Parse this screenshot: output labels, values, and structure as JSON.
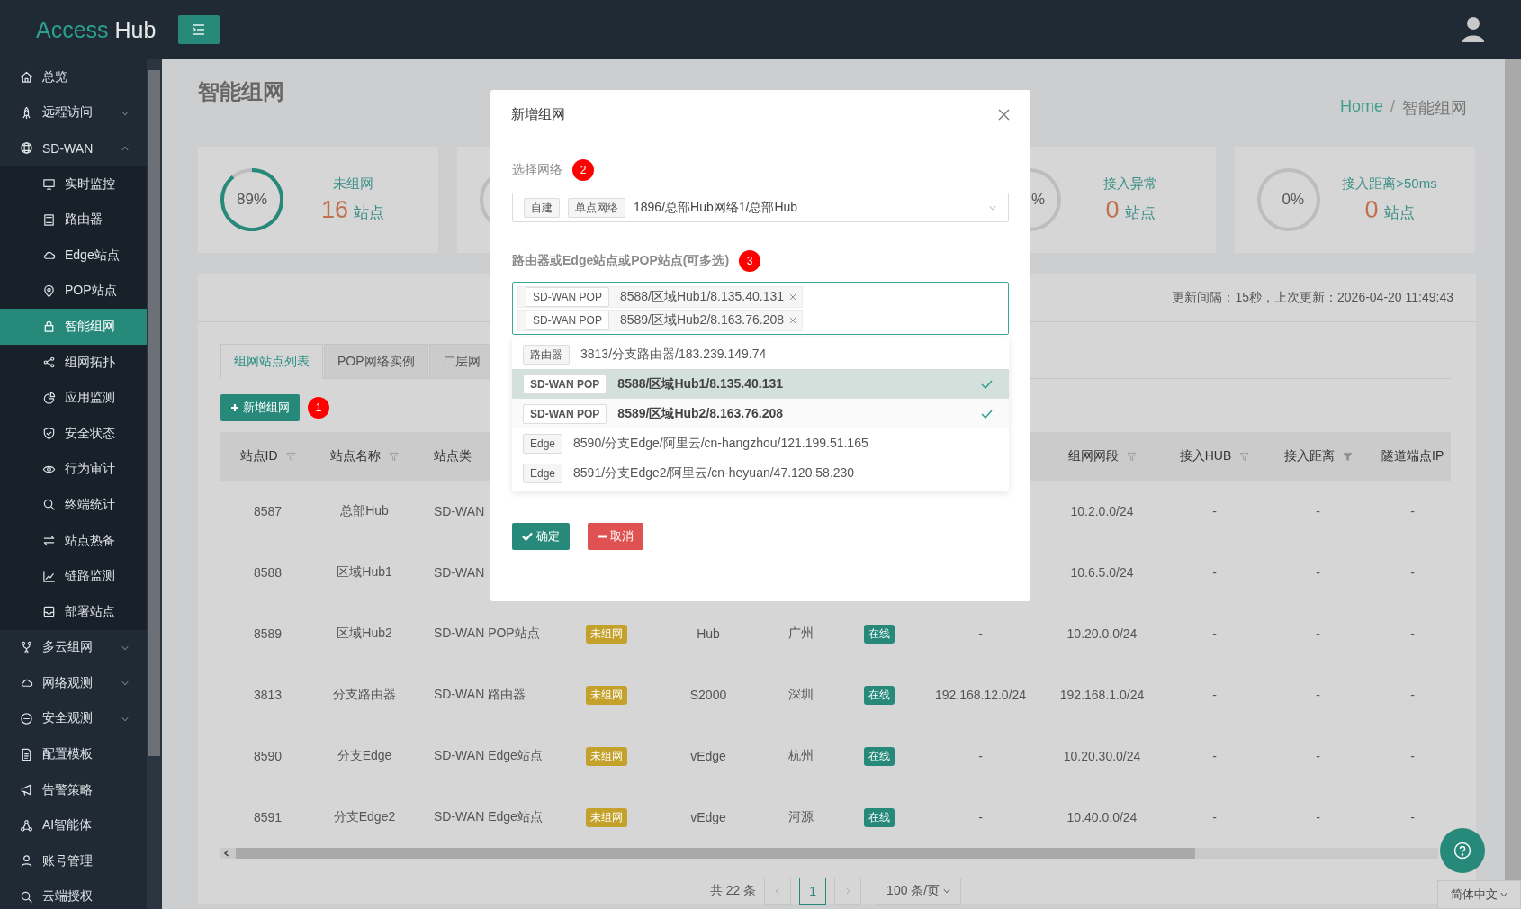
{
  "header": {
    "logo": {
      "first": "Access",
      "second": "Hub"
    }
  },
  "sidebar": {
    "items": [
      {
        "label": "总览",
        "selected": false
      },
      {
        "label": "远程访问",
        "selected": false,
        "expanded": false
      },
      {
        "label": "SD-WAN",
        "selected": false,
        "expanded": true,
        "children": [
          {
            "label": "实时监控",
            "selected": false
          },
          {
            "label": "路由器",
            "selected": false
          },
          {
            "label": "Edge站点",
            "selected": false
          },
          {
            "label": "POP站点",
            "selected": false
          },
          {
            "label": "智能组网",
            "selected": true
          },
          {
            "label": "组网拓扑",
            "selected": false
          },
          {
            "label": "应用监测",
            "selected": false
          },
          {
            "label": "安全状态",
            "selected": false
          },
          {
            "label": "行为审计",
            "selected": false
          },
          {
            "label": "终端统计",
            "selected": false
          },
          {
            "label": "站点热备",
            "selected": false
          },
          {
            "label": "链路监测",
            "selected": false
          },
          {
            "label": "部署站点",
            "selected": false
          }
        ]
      },
      {
        "label": "多云组网",
        "selected": false,
        "expanded": false
      },
      {
        "label": "网络观测",
        "selected": false,
        "expanded": false
      },
      {
        "label": "安全观测",
        "selected": false,
        "expanded": false
      },
      {
        "label": "配置模板",
        "selected": false
      },
      {
        "label": "告警策略",
        "selected": false
      },
      {
        "label": "AI智能体",
        "selected": false
      },
      {
        "label": "账号管理",
        "selected": false
      },
      {
        "label": "云端授权",
        "selected": false
      }
    ]
  },
  "page": {
    "title": "智能组网",
    "breadcrumb": {
      "home": "Home",
      "separator": "/",
      "current": "智能组网"
    }
  },
  "stats": [
    {
      "kind": "stat",
      "ring_label": "89%",
      "title": "未组网",
      "count": "16",
      "unit": "站点"
    },
    {
      "kind": "stat"
    },
    {
      "kind": "stat",
      "ring_label": "%",
      "title": "接入异常",
      "count": "0",
      "unit": "站点"
    },
    {
      "kind": "stat",
      "ring_label": "0%",
      "title": "接入距离>50ms",
      "count": "0",
      "unit": "站点"
    }
  ],
  "update_info": "更新间隔：15秒，上次更新：2026-04-20 11:49:43",
  "tabs": [
    {
      "label": "组网站点列表",
      "selected": true
    },
    {
      "label": "POP网络实例",
      "selected": false
    },
    {
      "label": "二层网",
      "selected": false
    }
  ],
  "add_button": {
    "label": "新增组网",
    "step": "1"
  },
  "table": {
    "columns": [
      {
        "kind": "text",
        "label": "站点ID",
        "filtered": false
      },
      {
        "kind": "text",
        "label": "站点名称",
        "filtered": false
      },
      {
        "kind": "text",
        "label": "站点类"
      },
      {
        "kind": "badge",
        "color": "#c4a12a"
      },
      {
        "kind": "text"
      },
      {
        "kind": "text"
      },
      {
        "kind": "badge",
        "color": "#26897a"
      },
      {
        "kind": "text"
      },
      {
        "kind": "text",
        "label": "组网网段",
        "filtered": false
      },
      {
        "kind": "text",
        "label": "接入HUB",
        "filtered": false
      },
      {
        "kind": "text",
        "label": "接入距离",
        "filtered": true
      },
      {
        "kind": "text",
        "label": "隧道端点IP"
      }
    ],
    "rows": [
      [
        "8587",
        "总部Hub",
        "SD-WAN",
        null,
        null,
        null,
        null,
        null,
        "10.2.0.0/24",
        "-",
        "-",
        "-"
      ],
      [
        "8588",
        "区域Hub1",
        "SD-WAN",
        null,
        null,
        null,
        null,
        null,
        "10.6.5.0/24",
        "-",
        "-",
        "-"
      ],
      [
        "8589",
        "区域Hub2",
        "SD-WAN POP站点",
        "未组网",
        "Hub",
        "广州",
        "在线",
        "-",
        "10.20.0.0/24",
        "-",
        "-",
        "-"
      ],
      [
        "3813",
        "分支路由器",
        "SD-WAN 路由器",
        "未组网",
        "S2000",
        "深圳",
        "在线",
        "192.168.12.0/24",
        "192.168.1.0/24",
        "-",
        "-",
        "-"
      ],
      [
        "8590",
        "分支Edge",
        "SD-WAN Edge站点",
        "未组网",
        "vEdge",
        "杭州",
        "在线",
        "-",
        "10.20.30.0/24",
        "-",
        "-",
        "-"
      ],
      [
        "8591",
        "分支Edge2",
        "SD-WAN Edge站点",
        "未组网",
        "vEdge",
        "河源",
        "在线",
        "-",
        "10.40.0.0/24",
        "-",
        "-",
        "-"
      ]
    ]
  },
  "pagination": {
    "total": "共 22 条",
    "prev_disabled": true,
    "pages": [
      {
        "label": "1",
        "selected": true
      }
    ],
    "next_disabled": true,
    "page_size": "100 条/页"
  },
  "language": "简体中文",
  "dialog": {
    "title": "新增组网",
    "network": {
      "label": "选择网络",
      "step": "2",
      "tags": [
        "自建",
        "单点网络"
      ],
      "value": "1896/总部Hub网络1/总部Hub"
    },
    "sites": {
      "label": "路由器或Edge站点或POP站点(可多选)",
      "step": "3",
      "chosen": [
        {
          "type": "SD-WAN POP",
          "value": "8588/区域Hub1/8.135.40.131"
        },
        {
          "type": "SD-WAN POP",
          "value": "8589/区域Hub2/8.163.76.208"
        }
      ],
      "options": [
        {
          "type": "路由器",
          "value": "3813/分支路由器/183.239.149.74",
          "selected": false,
          "highlighted": false
        },
        {
          "type": "SD-WAN POP",
          "value": "8588/区域Hub1/8.135.40.131",
          "selected": true,
          "highlighted": true
        },
        {
          "type": "SD-WAN POP",
          "value": "8589/区域Hub2/8.163.76.208",
          "selected": true,
          "highlighted": false
        },
        {
          "type": "Edge",
          "value": "8590/分支Edge/阿里云/cn-hangzhou/121.199.51.165",
          "selected": false,
          "highlighted": false
        },
        {
          "type": "Edge",
          "value": "8591/分支Edge2/阿里云/cn-heyuan/47.120.58.230",
          "selected": false,
          "highlighted": false
        }
      ]
    },
    "confirm": "确定",
    "cancel": "取消"
  }
}
